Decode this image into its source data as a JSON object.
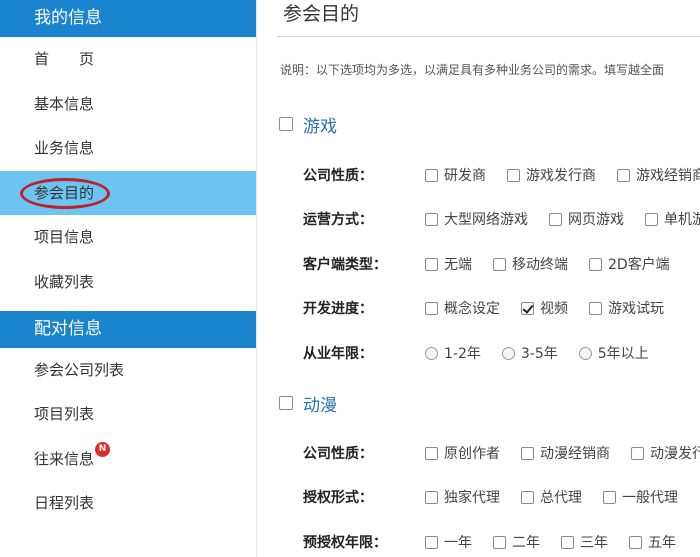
{
  "sidebar": {
    "section1": "我的信息",
    "items1": [
      {
        "label": "首　　页"
      },
      {
        "label": "基本信息"
      },
      {
        "label": "业务信息"
      },
      {
        "label": "参会目的"
      },
      {
        "label": "项目信息"
      },
      {
        "label": "收藏列表"
      }
    ],
    "section2": "配对信息",
    "items2": [
      {
        "label": "参会公司列表"
      },
      {
        "label": "项目列表"
      },
      {
        "label": "往来信息",
        "badge": "N"
      },
      {
        "label": "日程列表"
      }
    ]
  },
  "main": {
    "title": "参会目的",
    "note": "说明：以下选项均为多选，以满足具有多种业务公司的需求。填写越全面",
    "categories": [
      {
        "label": "游戏",
        "rows": [
          {
            "label": "公司性质：",
            "options": [
              {
                "label": "研发商",
                "checked": false
              },
              {
                "label": "游戏发行商",
                "checked": false
              },
              {
                "label": "游戏经销商",
                "checked": false
              }
            ]
          },
          {
            "label": "运营方式：",
            "options": [
              {
                "label": "大型网络游戏",
                "checked": false
              },
              {
                "label": "网页游戏",
                "checked": false
              },
              {
                "label": "单机游戏",
                "checked": false
              }
            ]
          },
          {
            "label": "客户端类型：",
            "options": [
              {
                "label": "无端",
                "checked": false
              },
              {
                "label": "移动终端",
                "checked": false
              },
              {
                "label": "2D客户端",
                "checked": false
              }
            ]
          },
          {
            "label": "开发进度：",
            "options": [
              {
                "label": "概念设定",
                "checked": false
              },
              {
                "label": "视频",
                "checked": true
              },
              {
                "label": "游戏试玩",
                "checked": false
              }
            ]
          },
          {
            "label": "从业年限：",
            "options": [
              {
                "label": "1-2年"
              },
              {
                "label": "3-5年"
              },
              {
                "label": "5年以上"
              }
            ]
          }
        ]
      },
      {
        "label": "动漫",
        "rows": [
          {
            "label": "公司性质：",
            "options": [
              {
                "label": "原创作者",
                "checked": false
              },
              {
                "label": "动漫经销商",
                "checked": false
              },
              {
                "label": "动漫发行商",
                "checked": false
              }
            ]
          },
          {
            "label": "授权形式：",
            "options": [
              {
                "label": "独家代理",
                "checked": false
              },
              {
                "label": "总代理",
                "checked": false
              },
              {
                "label": "一般代理",
                "checked": false
              }
            ]
          },
          {
            "label": "预授权年限：",
            "options": [
              {
                "label": "一年",
                "checked": false
              },
              {
                "label": "二年",
                "checked": false
              },
              {
                "label": "三年",
                "checked": false
              },
              {
                "label": "五年",
                "checked": false
              }
            ]
          }
        ]
      }
    ]
  }
}
